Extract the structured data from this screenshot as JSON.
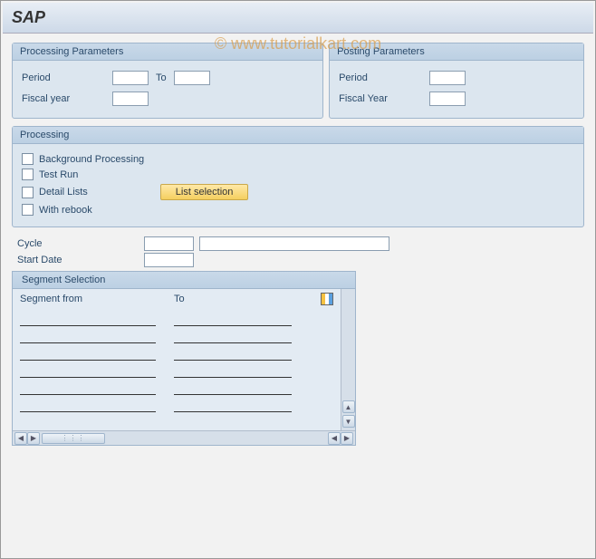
{
  "app_title": "SAP",
  "watermark": "© www.tutorialkart.com",
  "processing_params": {
    "title": "Processing Parameters",
    "period_label": "Period",
    "period_from": "",
    "to_label": "To",
    "period_to": "",
    "fiscal_label": "Fiscal year",
    "fiscal_value": ""
  },
  "posting_params": {
    "title": "Posting Parameters",
    "period_label": "Period",
    "period_value": "",
    "fiscal_label": "Fiscal Year",
    "fiscal_value": ""
  },
  "processing": {
    "title": "Processing",
    "bg_label": "Background Processing",
    "test_label": "Test Run",
    "detail_label": "Detail Lists",
    "rebook_label": "With rebook",
    "list_btn": "List selection"
  },
  "cycle_label": "Cycle",
  "cycle_value_short": "",
  "cycle_value_long": "",
  "start_date_label": "Start Date",
  "start_date_value": "",
  "segment": {
    "title": "Segment Selection",
    "col_from": "Segment from",
    "col_to": "To",
    "rows": [
      "",
      "",
      "",
      "",
      "",
      "",
      ""
    ]
  }
}
